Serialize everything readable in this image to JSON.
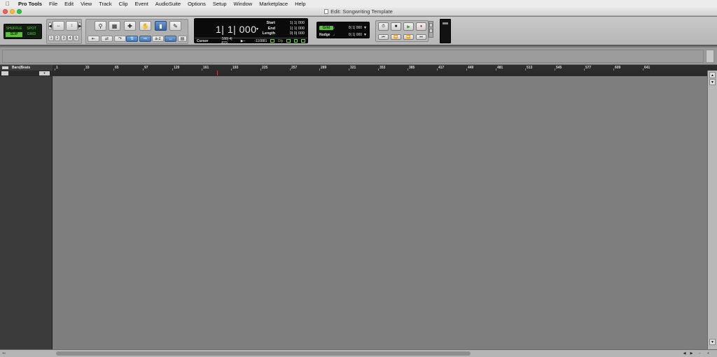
{
  "menubar": {
    "apple": "",
    "items": [
      "Pro Tools",
      "File",
      "Edit",
      "View",
      "Track",
      "Clip",
      "Event",
      "AudioSuite",
      "Options",
      "Setup",
      "Window",
      "Marketplace",
      "Help"
    ]
  },
  "window": {
    "title": "Edit: Songwriting Template"
  },
  "edit_modes": {
    "shuffle": "SHUFFLE",
    "spot": "SPOT",
    "slip": "SLIP",
    "grid": "GRID",
    "active": "SLIP"
  },
  "zoom_presets": [
    "1",
    "2",
    "3",
    "4",
    "5"
  ],
  "counter": {
    "main": "1| 1| 000",
    "start_label": "Start",
    "end_label": "End",
    "length_label": "Length",
    "start": "1| 1| 000",
    "end": "1| 1| 000",
    "length": "0| 0| 000",
    "cursor_label": "Cursor",
    "cursor_value": "188| 4| 879",
    "cursor_sample": "-110881",
    "dly_label": "Dly"
  },
  "grid_nudge": {
    "grid_label": "Grid",
    "grid_value": "0| 1| 000",
    "nudge_label": "Nudge",
    "nudge_value": "0| 1| 000"
  },
  "ruler": {
    "label": "Bars|Beats",
    "ticks": [
      "1",
      "33",
      "65",
      "97",
      "129",
      "161",
      "193",
      "225",
      "257",
      "289",
      "321",
      "353",
      "385",
      "417",
      "449",
      "481",
      "513",
      "545",
      "577",
      "609",
      "641"
    ]
  },
  "colors": {
    "accent_green": "#5fbf3a",
    "record_red": "#d0202a",
    "play_green": "#2e9c2e"
  }
}
